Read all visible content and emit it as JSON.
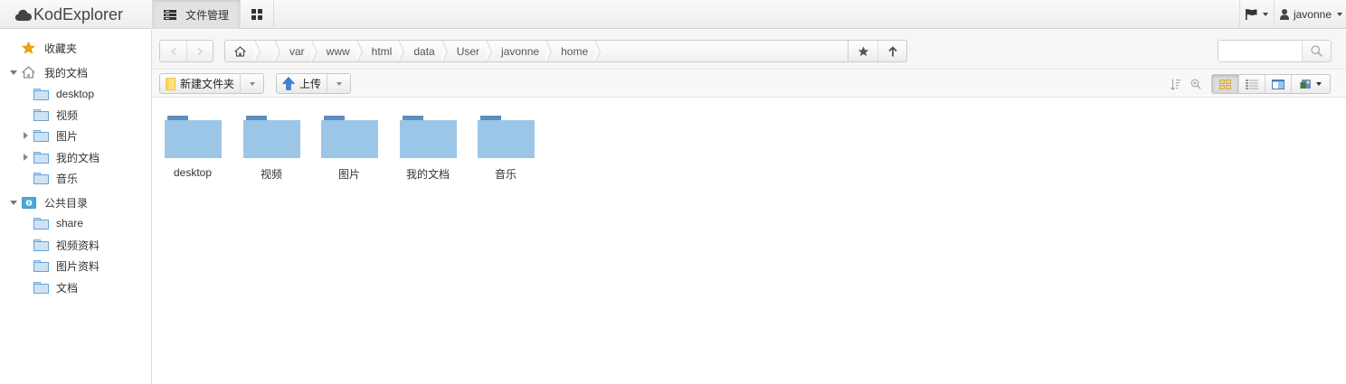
{
  "app": {
    "title": "KodExplorer"
  },
  "topnav": {
    "tabs": [
      {
        "label": "文件管理",
        "icon": "file-manager-icon",
        "active": true
      },
      {
        "label": "",
        "icon": "grid-apps-icon",
        "active": false
      }
    ]
  },
  "topright": {
    "language_icon": "flag-icon",
    "user": {
      "name": "javonne",
      "icon": "user-icon"
    }
  },
  "sidebar": {
    "favorites": {
      "label": "收藏夹",
      "icon": "star-icon"
    },
    "my_docs": {
      "label": "我的文档",
      "icon": "home-icon",
      "children": [
        {
          "label": "desktop",
          "expandable": false
        },
        {
          "label": "视频",
          "expandable": false
        },
        {
          "label": "图片",
          "expandable": true
        },
        {
          "label": "我的文档",
          "expandable": true
        },
        {
          "label": "音乐",
          "expandable": false
        }
      ]
    },
    "public": {
      "label": "公共目录",
      "icon": "public-folder-icon",
      "children": [
        {
          "label": "share"
        },
        {
          "label": "视频资料"
        },
        {
          "label": "图片资料"
        },
        {
          "label": "文档"
        }
      ]
    }
  },
  "pathbar": {
    "breadcrumbs": [
      "var",
      "www",
      "html",
      "data",
      "User",
      "javonne",
      "home"
    ],
    "search": {
      "placeholder": "",
      "value": ""
    }
  },
  "toolbar": {
    "new_folder_label": "新建文件夹",
    "upload_label": "上传"
  },
  "files": [
    {
      "name": "desktop",
      "type": "folder"
    },
    {
      "name": "视频",
      "type": "folder"
    },
    {
      "name": "图片",
      "type": "folder"
    },
    {
      "name": "我的文档",
      "type": "folder"
    },
    {
      "name": "音乐",
      "type": "folder"
    }
  ],
  "colors": {
    "folder_body": "#9cc6e8",
    "folder_tab": "#5b8fbf",
    "accent_blue": "#3a86d1",
    "star": "#f0a30a"
  }
}
